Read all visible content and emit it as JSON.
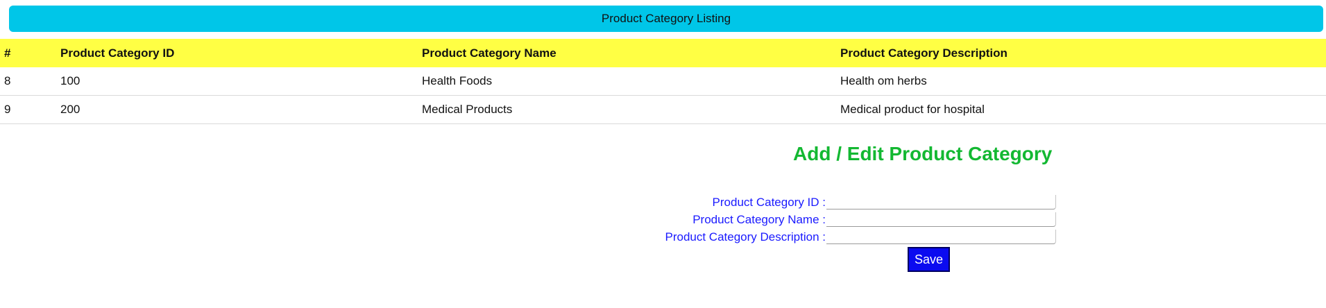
{
  "banner": {
    "title": "Product Category Listing"
  },
  "table": {
    "headers": [
      "#",
      "Product Category ID",
      "Product Category Name",
      "Product Category Description"
    ],
    "rows": [
      [
        "8",
        "100",
        "Health Foods",
        "Health om herbs"
      ],
      [
        "9",
        "200",
        "Medical Products",
        "Medical product for hospital"
      ]
    ]
  },
  "form": {
    "title": "Add / Edit Product Category",
    "fields": [
      {
        "label": "Product Category ID :",
        "value": ""
      },
      {
        "label": "Product Category Name :",
        "value": ""
      },
      {
        "label": "Product Category Description :",
        "value": ""
      }
    ],
    "save_label": "Save"
  },
  "colors": {
    "banner": "#00c6e8",
    "header_row": "#ffff44",
    "form_title": "#13b832",
    "form_label": "#1a1aff",
    "save_button": "#0b0bf0"
  }
}
